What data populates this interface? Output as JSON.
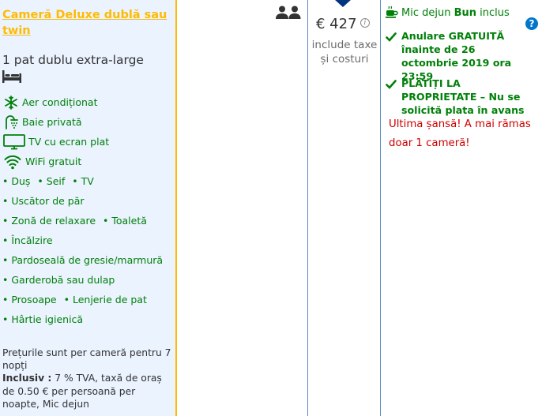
{
  "room": {
    "title": "Cameră Deluxe dublă sau twin",
    "bed": "1 pat dublu extra-large",
    "facilities": [
      {
        "icon": "snowflake-icon",
        "label": "Aer condiționat"
      },
      {
        "icon": "shower-icon",
        "label": "Baie privată"
      },
      {
        "icon": "tv-icon",
        "label": "TV cu ecran plat"
      },
      {
        "icon": "wifi-icon",
        "label": "WiFi gratuit"
      }
    ],
    "amenities": {
      "row1": [
        "• Duș",
        "• Seif",
        "• TV"
      ],
      "row2": [
        "• Uscător de păr"
      ],
      "row3": [
        "• Zonă de relaxare",
        "• Toaletă"
      ],
      "row4": [
        "• Încălzire"
      ],
      "row5": [
        "• Pardoseală de gresie/marmură"
      ],
      "row6": [
        "• Garderobă sau dulap"
      ],
      "row7": [
        "• Prosoape",
        "• Lenjerie de pat"
      ],
      "row8": [
        "• Hârtie igienică"
      ]
    },
    "note_prefix": "Prețurile sunt per cameră pentru 7 nopți",
    "note_included_label": "Inclusiv :",
    "note_included_text": " 7 % TVA, taxă de oraș de 0.50 € per persoană per noapte, Mic dejun"
  },
  "guests": {
    "icon": "two-persons-icon",
    "count": 2
  },
  "price": {
    "amount": "€ 427",
    "info_icon": "i",
    "sub": "include taxe și costuri"
  },
  "conditions": {
    "breakfast_prefix": "Mic dejun ",
    "breakfast_bold": "Bun",
    "breakfast_suffix": " inclus",
    "help": "?",
    "cancel": "Anulare GRATUITĂ înainte de 26 octombrie 2019 ora 23:59",
    "pay": "PLĂTIȚI LA PROPRIETATE – Nu se solicită plata în avans",
    "urgent": "Ultima șansă! A mai rămas doar 1 cameră!"
  },
  "colors": {
    "accent": "#febb02",
    "green": "#008009",
    "blue": "#003580",
    "red": "#cc0000",
    "panel": "#ebf3ff"
  }
}
